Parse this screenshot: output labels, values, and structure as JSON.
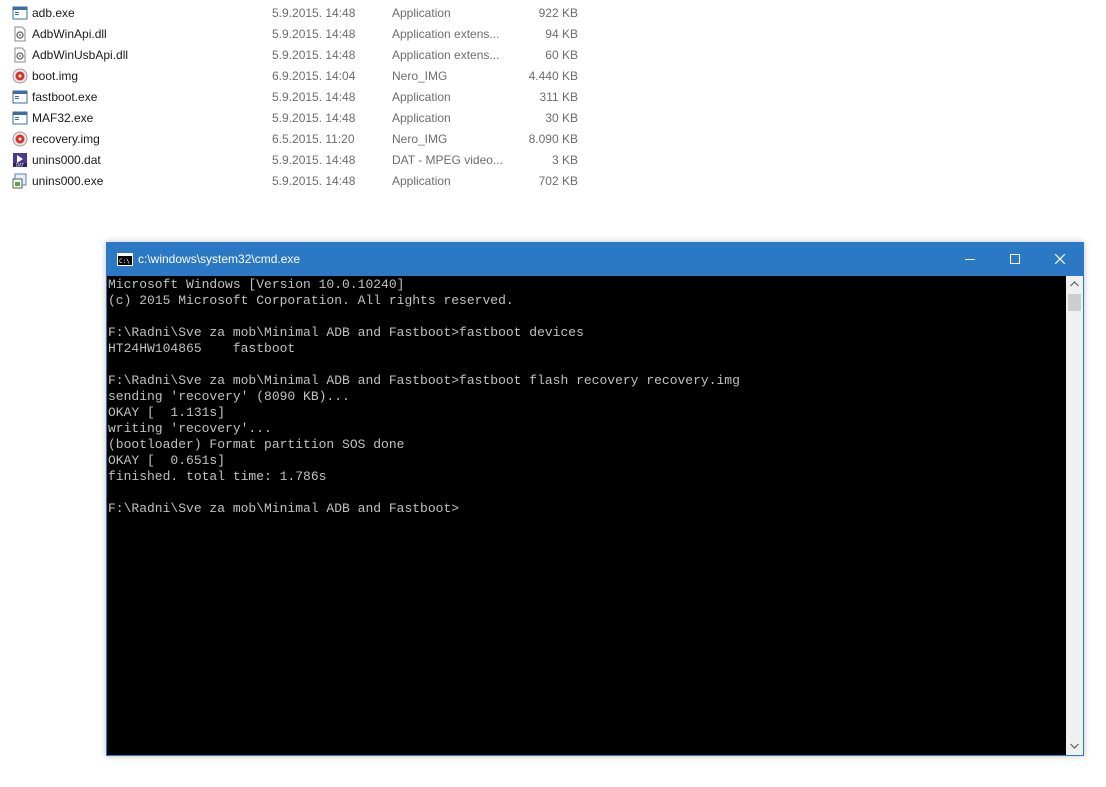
{
  "files": [
    {
      "name": "adb.exe",
      "date": "5.9.2015. 14:48",
      "type": "Application",
      "size": "922 KB",
      "icon": "exe-window-icon"
    },
    {
      "name": "AdbWinApi.dll",
      "date": "5.9.2015. 14:48",
      "type": "Application extens...",
      "size": "94 KB",
      "icon": "dll-gear-icon"
    },
    {
      "name": "AdbWinUsbApi.dll",
      "date": "5.9.2015. 14:48",
      "type": "Application extens...",
      "size": "60 KB",
      "icon": "dll-gear-icon"
    },
    {
      "name": "boot.img",
      "date": "6.9.2015. 14:04",
      "type": "Nero_IMG",
      "size": "4.440 KB",
      "icon": "nero-disc-icon"
    },
    {
      "name": "fastboot.exe",
      "date": "5.9.2015. 14:48",
      "type": "Application",
      "size": "311 KB",
      "icon": "exe-window-icon"
    },
    {
      "name": "MAF32.exe",
      "date": "5.9.2015. 14:48",
      "type": "Application",
      "size": "30 KB",
      "icon": "exe-window-icon"
    },
    {
      "name": "recovery.img",
      "date": "6.5.2015. 11:20",
      "type": "Nero_IMG",
      "size": "8.090 KB",
      "icon": "nero-disc-icon"
    },
    {
      "name": "unins000.dat",
      "date": "5.9.2015. 14:48",
      "type": "DAT - MPEG video...",
      "size": "3 KB",
      "icon": "dat-video-icon"
    },
    {
      "name": "unins000.exe",
      "date": "5.9.2015. 14:48",
      "type": "Application",
      "size": "702 KB",
      "icon": "installer-icon"
    }
  ],
  "cmd": {
    "title": "c:\\windows\\system32\\cmd.exe",
    "app_icon": "cmd-prompt-icon",
    "buttons": {
      "minimize": "minimize-icon",
      "maximize": "maximize-icon",
      "close": "close-icon"
    },
    "output": "Microsoft Windows [Version 10.0.10240]\n(c) 2015 Microsoft Corporation. All rights reserved.\n\nF:\\Radni\\Sve za mob\\Minimal ADB and Fastboot>fastboot devices\nHT24HW104865    fastboot\n\nF:\\Radni\\Sve za mob\\Minimal ADB and Fastboot>fastboot flash recovery recovery.img\nsending 'recovery' (8090 KB)...\nOKAY [  1.131s]\nwriting 'recovery'...\n(bootloader) Format partition SOS done\nOKAY [  0.651s]\nfinished. total time: 1.786s\n\nF:\\Radni\\Sve za mob\\Minimal ADB and Fastboot>"
  },
  "colors": {
    "titlebar": "#2b78c5",
    "console_bg": "#000000",
    "console_text": "#c0c0c0"
  }
}
